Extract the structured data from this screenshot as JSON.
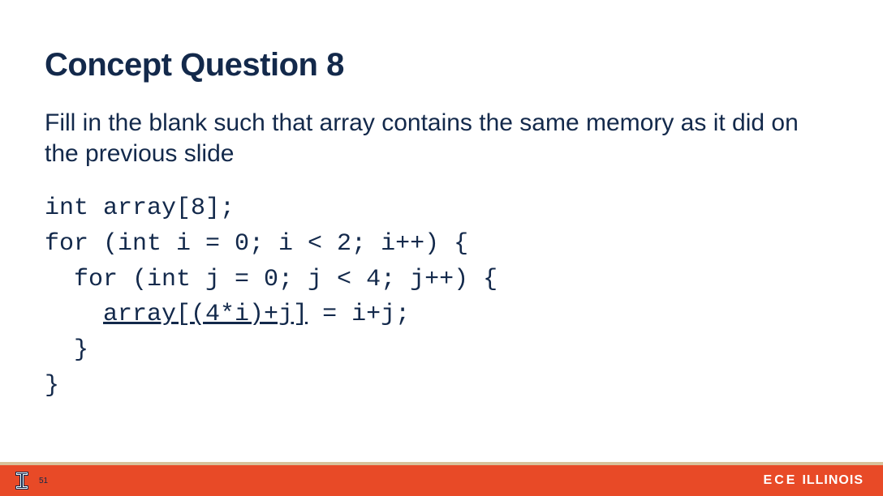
{
  "title": "Concept Question 8",
  "subtitle": "Fill in the blank such that array contains the same memory as it did on the previous slide",
  "code": {
    "line1": "int array[8];",
    "line2": "for (int i = 0; i < 2; i++) {",
    "line3": "  for (int j = 0; j < 4; j++) {",
    "line4a": "    ",
    "line4u": "array[(4*i)+j]",
    "line4b": " = i+j;",
    "line5": "  }",
    "line6": "}"
  },
  "footer": {
    "page": "51",
    "brand_bold": "ECE",
    "brand_light": "ILLINOIS"
  }
}
